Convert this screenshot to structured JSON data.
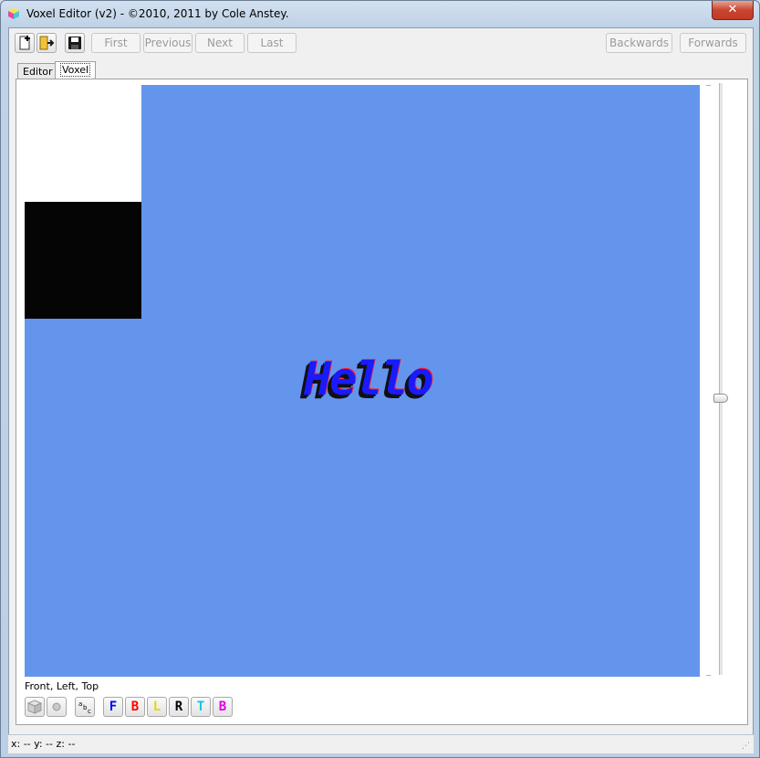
{
  "window": {
    "title": "Voxel Editor (v2) - ©2010, 2011 by Cole Anstey.",
    "close_label": "✕"
  },
  "toolbar": {
    "new_icon": "new-file-icon",
    "open_icon": "open-folder-icon",
    "save_icon": "save-disk-icon",
    "nav": [
      "First",
      "Previous",
      "Next",
      "Last"
    ],
    "history": [
      "Backwards",
      "Forwards"
    ]
  },
  "tabs": [
    {
      "label": "Editor",
      "active": false
    },
    {
      "label": "Voxel",
      "active": true
    }
  ],
  "viewport": {
    "background_color": "#6495ed",
    "rendered_text": "Hello",
    "text_color": "#1a1aff"
  },
  "view_label": "Front, Left, Top",
  "view_buttons": {
    "shading_icon": "cube-icon",
    "sphere_icon": "sphere-icon",
    "text_icon": "abc-text-icon",
    "faces": [
      {
        "label": "F",
        "color": "#0000ff"
      },
      {
        "label": "B",
        "color": "#ff0000"
      },
      {
        "label": "L",
        "color": "#e8d800"
      },
      {
        "label": "R",
        "color": "#000000"
      },
      {
        "label": "T",
        "color": "#00c8e8"
      },
      {
        "label": "B",
        "color": "#e000e0"
      }
    ]
  },
  "status": {
    "coords": "x: -- y: -- z: --"
  }
}
